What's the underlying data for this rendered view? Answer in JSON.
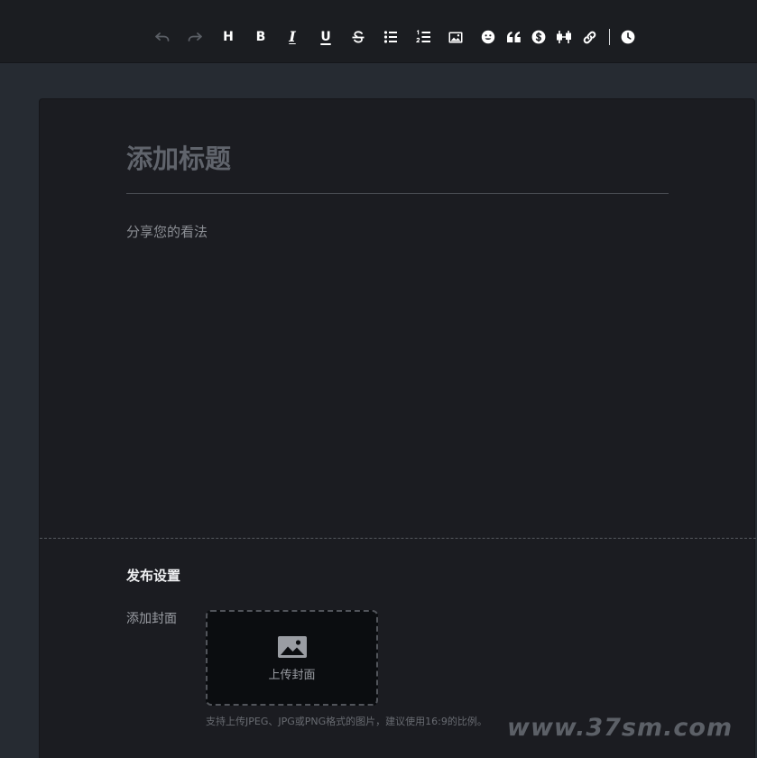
{
  "toolbar": {
    "heading_label": "H",
    "bold_label": "B",
    "italic_label": "I",
    "underline_label": "U"
  },
  "editor": {
    "title_placeholder": "添加标题",
    "body_placeholder": "分享您的看法"
  },
  "publish": {
    "section_title": "发布设置",
    "cover_label": "添加封面",
    "upload_label": "上传封面",
    "hint": "支持上传JPEG、JPG或PNG格式的图片，建议使用16:9的比例。"
  },
  "watermark": "www.37sm.com",
  "colors": {
    "page_bg": "#262b32",
    "toolbar_bg": "#1b1d21",
    "card_bg": "#1b1c21",
    "icon": "#ffffff",
    "icon_disabled": "#5b5f66"
  }
}
